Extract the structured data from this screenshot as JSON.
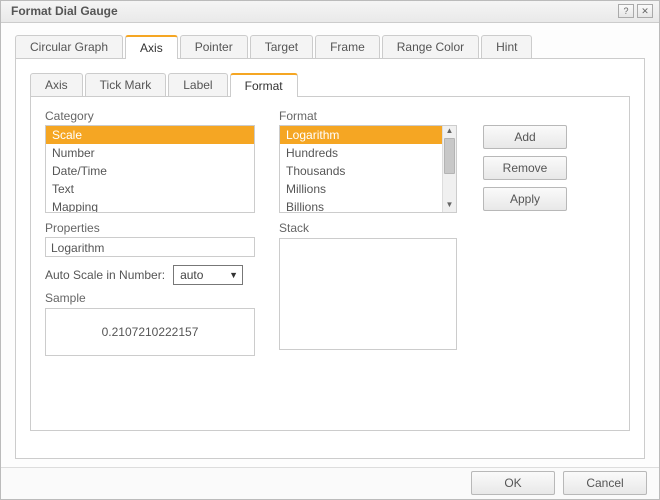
{
  "window": {
    "title": "Format Dial Gauge",
    "help_icon": "?",
    "close_icon": "✕"
  },
  "outer_tabs": {
    "items": [
      {
        "label": "Circular Graph"
      },
      {
        "label": "Axis"
      },
      {
        "label": "Pointer"
      },
      {
        "label": "Target"
      },
      {
        "label": "Frame"
      },
      {
        "label": "Range Color"
      },
      {
        "label": "Hint"
      }
    ],
    "active_index": 1
  },
  "inner_tabs": {
    "items": [
      {
        "label": "Axis"
      },
      {
        "label": "Tick Mark"
      },
      {
        "label": "Label"
      },
      {
        "label": "Format"
      }
    ],
    "active_index": 3
  },
  "category": {
    "label": "Category",
    "items": [
      "Scale",
      "Number",
      "Date/Time",
      "Text",
      "Mapping"
    ],
    "selected_index": 0
  },
  "format": {
    "label": "Format",
    "items": [
      "Logarithm",
      "Hundreds",
      "Thousands",
      "Millions",
      "Billions"
    ],
    "selected_index": 0
  },
  "properties": {
    "label": "Properties",
    "value": "Logarithm"
  },
  "auto_scale": {
    "label": "Auto Scale in Number:",
    "value": "auto"
  },
  "sample": {
    "label": "Sample",
    "value": "0.2107210222157"
  },
  "stack": {
    "label": "Stack"
  },
  "side_buttons": {
    "add": "Add",
    "remove": "Remove",
    "apply": "Apply"
  },
  "footer": {
    "ok": "OK",
    "cancel": "Cancel"
  }
}
